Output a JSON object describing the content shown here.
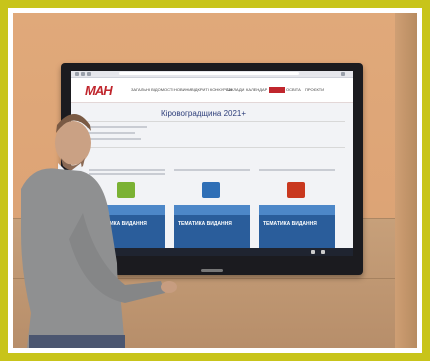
{
  "screen": {
    "logo": "МАН",
    "nav": [
      "ЗАГАЛЬНІ ВІДОМОСТІ",
      "НОВИНИ",
      "ВІДКРИТІ КОНКУРСИ",
      "ЗАКЛАДИ",
      "КАЛЕНДАР",
      "",
      "ОСВІТА",
      "ПРОЄКТИ"
    ],
    "title": "Кіровоградщина 2021+",
    "cards": [
      {
        "poster": "ТЕМАТИКА ВИДАННЯ",
        "color": "#7bb234"
      },
      {
        "poster": "ТЕМАТИКА ВИДАННЯ",
        "color": "#2f6fb6"
      },
      {
        "poster": "ТЕМАТИКА ВИДАННЯ",
        "color": "#c9381f"
      }
    ]
  },
  "colors": {
    "frame": "#c8c41a",
    "brand": "#c0262d",
    "title": "#2d3e7a"
  }
}
